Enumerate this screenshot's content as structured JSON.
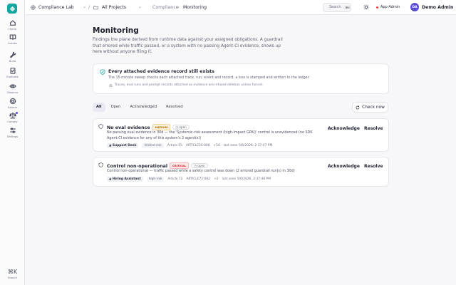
{
  "nav": {
    "items": [
      {
        "label": "Home"
      },
      {
        "label": "Guides"
      },
      {
        "label": "Build"
      },
      {
        "label": "Evaluate"
      },
      {
        "label": "Observe"
      },
      {
        "label": "Govern"
      },
      {
        "label": "Comply"
      },
      {
        "label": "Settings"
      }
    ],
    "search_label": "Search",
    "search_shortcut": "⌘K"
  },
  "topbar": {
    "workspace": "Compliance Lab",
    "project": "All Projects",
    "breadcrumb_parent": "Compliance",
    "breadcrumb_current": "Monitoring",
    "search_label": "Search",
    "search_shortcut": "⌘K",
    "env_label": "App Admin",
    "user_initials": "DA",
    "user_name": "Demo Admin"
  },
  "page": {
    "title": "Monitoring",
    "description": "Findings the plane derived from runtime data against your assigned obligations. A guardrail that errored while traffic passed, or a system with no passing Agent-CI evidence, shows up here without anyone filing it."
  },
  "banner": {
    "title": "Every attached evidence record still exists",
    "subtitle": "The 15-minute sweep checks each attached trace, run, event and record; a loss is stamped and written to the ledger.",
    "note": "Traces, eval runs and prompt records attached as evidence are refused deletion unless forced."
  },
  "tabs": [
    {
      "label": "All",
      "active": true
    },
    {
      "label": "Open",
      "active": false
    },
    {
      "label": "Acknowledged",
      "active": false
    },
    {
      "label": "Resolved",
      "active": false
    }
  ],
  "check_now_label": "Check now",
  "findings": [
    {
      "title": "No eval evidence",
      "severity": "MEDIUM",
      "status": "open",
      "description": "No passing eval evidence in 30d — the 'Systemic-risk assessment (high-impact GPAI)' control is unevidenced (no SDK Agent-CI evidence for any of this system's 2 agent(s))",
      "system": "Support Desk",
      "risk": "limited risk",
      "article": "Article 55",
      "ref": "ARTICLE55-008",
      "extra": "+54",
      "last_seen": "last seen 5/6/2026, 2:37:47 PM",
      "acknowledge_label": "Acknowledge",
      "resolve_label": "Resolve"
    },
    {
      "title": "Control non-operational",
      "severity": "CRITICAL",
      "status": "open",
      "description": "Control non-operational — traffic passed while a safety control was down (2 errored guardrail run(s) in 30d)",
      "system": "Hiring Assistant",
      "risk": "high risk",
      "article": "Article 72",
      "ref": "ARTICLE72-062",
      "extra": "+2",
      "last_seen": "last seen 5/6/2026, 2:37:46 PM",
      "acknowledge_label": "Acknowledge",
      "resolve_label": "Resolve"
    }
  ],
  "colors": {
    "brand": "#14a5a0",
    "accent": "#5b4bd8",
    "medium": "#b26a00",
    "critical": "#c62828",
    "env_dot": "#e5484d"
  }
}
